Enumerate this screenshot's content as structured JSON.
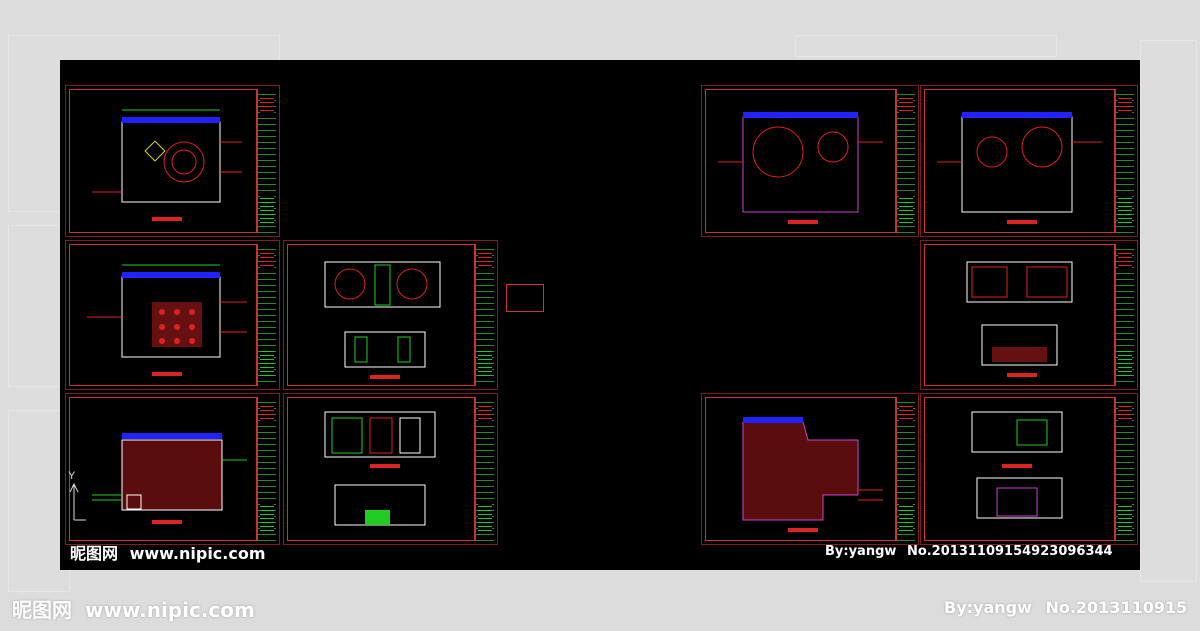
{
  "watermark": {
    "site_cn": "昵图网",
    "site_url": "www.nipic.com",
    "credit": "By:yangw",
    "number": "No.20131109154923096344",
    "number_cropped": "No.2013110915"
  },
  "axis": {
    "y_label": "Y"
  },
  "colors": {
    "sheet_border": "#c33",
    "cad_red": "#d22",
    "cad_green": "#2c2",
    "cad_blue": "#22f",
    "cad_magenta": "#c4c",
    "cad_white": "#fff"
  }
}
